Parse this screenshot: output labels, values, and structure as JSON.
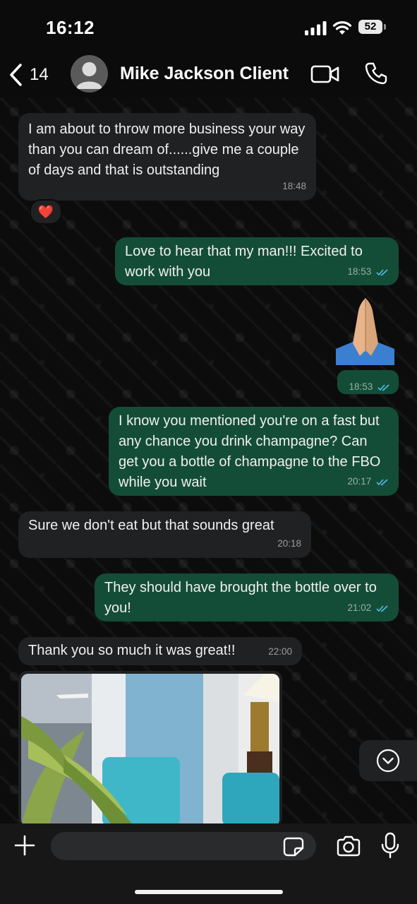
{
  "status_bar": {
    "time": "16:12",
    "battery": "52"
  },
  "header": {
    "back_count": "14",
    "contact_name": "Mike Jackson Client",
    "icons": {
      "back": "chevron-left-icon",
      "video": "video-call-icon",
      "call": "phone-icon",
      "avatar": "person-icon"
    }
  },
  "messages": [
    {
      "direction": "incoming",
      "text": "I am about to throw more business your way than you can dream of......give me a couple of days and that is outstanding",
      "time": "18:48",
      "reaction": "❤️"
    },
    {
      "direction": "outgoing",
      "text": "Love to hear that my man!!! Excited to work with you",
      "time": "18:53",
      "status": "read"
    },
    {
      "direction": "outgoing",
      "text": "🙏🏼",
      "time": "18:53",
      "status": "read",
      "kind": "emoji"
    },
    {
      "direction": "outgoing",
      "text": "I know you mentioned you're on a fast but any chance you drink champagne? Can get you a bottle of champagne to the FBO while you wait",
      "time": "20:17",
      "status": "read"
    },
    {
      "direction": "incoming",
      "text": "Sure we don't eat but that sounds great",
      "time": "20:18"
    },
    {
      "direction": "outgoing",
      "text": "They should have brought the bottle over to you!",
      "time": "21:02",
      "status": "read"
    },
    {
      "direction": "incoming",
      "text": "Thank you so much it was great!!",
      "time": "22:00"
    },
    {
      "direction": "incoming",
      "kind": "photo"
    }
  ],
  "colors": {
    "incoming_bubble": "#1f2123",
    "outgoing_bubble": "#144d37",
    "read_ticks": "#53bdeb",
    "background": "#0b0b0b"
  },
  "composer": {
    "icons": {
      "attach": "plus-icon",
      "sticker": "sticker-icon",
      "camera": "camera-icon",
      "mic": "microphone-icon"
    }
  },
  "scroll_down_icon": "chevron-down-circle-icon"
}
